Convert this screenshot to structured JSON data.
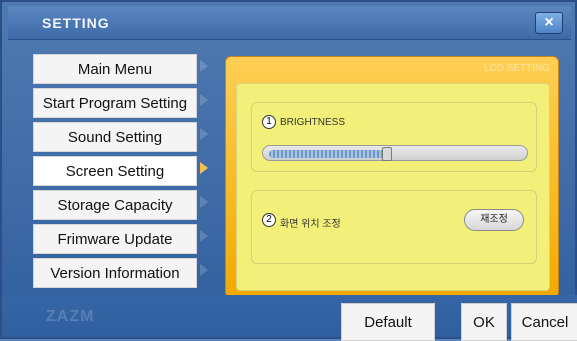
{
  "window": {
    "title": "SETTING",
    "close_icon": "close-icon"
  },
  "menu": {
    "items": [
      {
        "label": "Main Menu"
      },
      {
        "label": "Start Program Setting"
      },
      {
        "label": "Sound Setting"
      },
      {
        "label": "Screen Setting",
        "active": true
      },
      {
        "label": "Storage Capacity"
      },
      {
        "label": "Frimware Update"
      },
      {
        "label": "Version Information"
      }
    ]
  },
  "panel": {
    "title": "LCD SETTING",
    "brightness": {
      "index": "1",
      "label": "BRIGHTNESS",
      "value_fraction": 0.47
    },
    "screen_position": {
      "index": "2",
      "label": "화면 위치 조정",
      "button_label": "재조정"
    }
  },
  "footer": {
    "brand": "ZAZM",
    "default_label": "Default",
    "ok_label": "OK",
    "cancel_label": "Cancel"
  },
  "colors": {
    "accent_orange": "#F2A900",
    "panel_yellow": "#F3F07A",
    "window_blue": "#3E6AA6"
  }
}
